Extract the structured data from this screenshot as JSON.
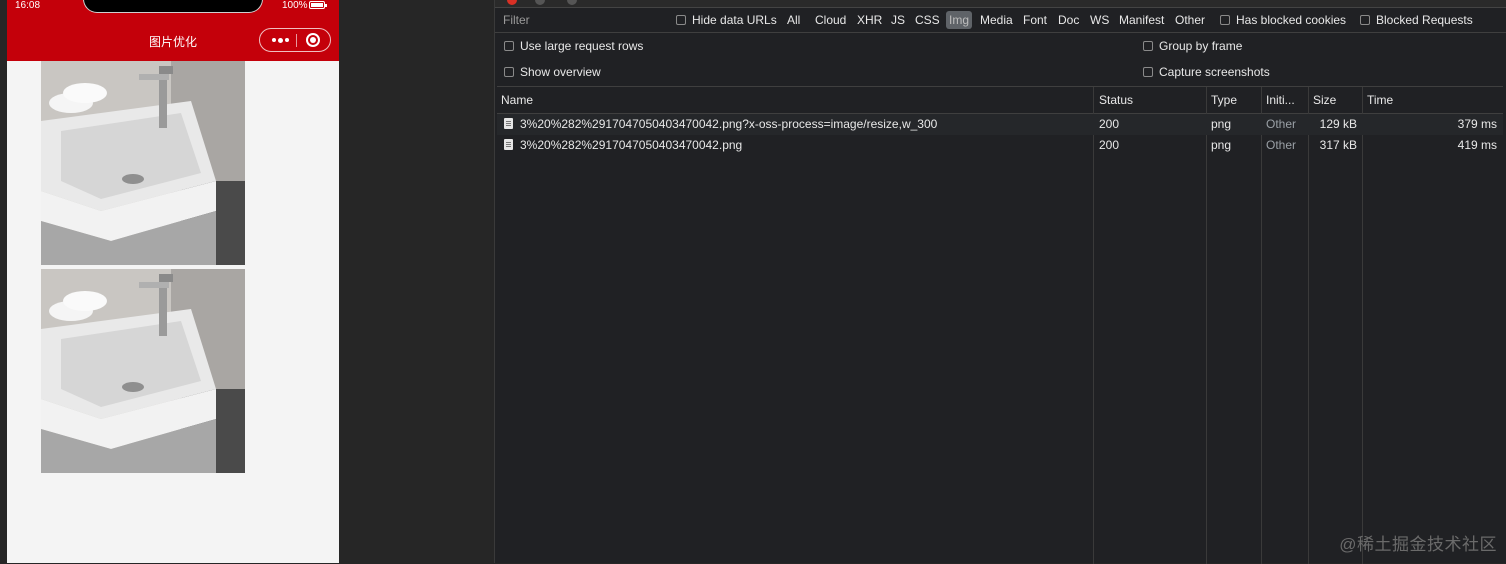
{
  "phone": {
    "status_time": "16:08",
    "status_battery": "100%",
    "nav_title": "图片优化",
    "brand_color": "#c4000a",
    "icons": [
      "more-icon",
      "close-icon",
      "battery-icon"
    ]
  },
  "images": [
    {
      "name": "sink-image-1",
      "icon": "sink-photo"
    },
    {
      "name": "sink-image-2",
      "icon": "sink-photo"
    }
  ],
  "devtools": {
    "filter_placeholder": "Filter",
    "hide_data_urls": "Hide data URLs",
    "types": [
      "All",
      "Cloud",
      "XHR",
      "JS",
      "CSS",
      "Img",
      "Media",
      "Font",
      "Doc",
      "WS",
      "Manifest",
      "Other"
    ],
    "active_type": "Img",
    "has_blocked_cookies": "Has blocked cookies",
    "blocked_requests": "Blocked Requests",
    "use_large_rows": "Use large request rows",
    "show_overview": "Show overview",
    "group_by_frame": "Group by frame",
    "capture_screenshots": "Capture screenshots",
    "columns": {
      "name": "Name",
      "status": "Status",
      "type": "Type",
      "initiator": "Initi...",
      "size": "Size",
      "time": "Time"
    },
    "rows": [
      {
        "name": "3%20%282%2917047050403470042.png?x-oss-process=image/resize,w_300",
        "status": "200",
        "type": "png",
        "initiator": "Other",
        "size": "129 kB",
        "time": "379 ms"
      },
      {
        "name": "3%20%282%2917047050403470042.png",
        "status": "200",
        "type": "png",
        "initiator": "Other",
        "size": "317 kB",
        "time": "419 ms"
      }
    ]
  },
  "watermark": "@稀土掘金技术社区"
}
